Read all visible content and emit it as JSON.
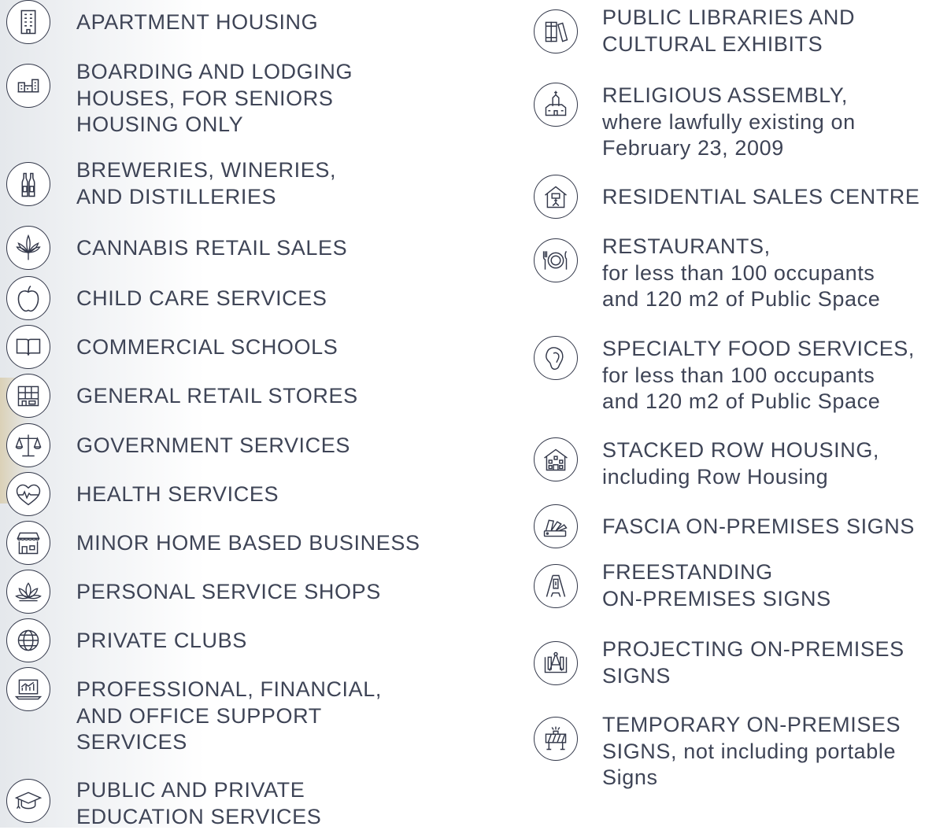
{
  "left_column": [
    {
      "icon": "apartment-building-icon",
      "lines": [
        "APARTMENT HOUSING"
      ]
    },
    {
      "icon": "boarding-houses-icon",
      "lines": [
        "BOARDING AND LODGING",
        "HOUSES, FOR SENIORS",
        "HOUSING ONLY"
      ]
    },
    {
      "icon": "bottles-icon",
      "lines": [
        "BREWERIES, WINERIES,",
        "AND DISTILLERIES"
      ]
    },
    {
      "icon": "cannabis-leaf-icon",
      "lines": [
        "CANNABIS RETAIL SALES"
      ]
    },
    {
      "icon": "apple-icon",
      "lines": [
        "CHILD CARE SERVICES"
      ]
    },
    {
      "icon": "open-book-icon",
      "lines": [
        "COMMERCIAL SCHOOLS"
      ]
    },
    {
      "icon": "storefront-icon",
      "lines": [
        "GENERAL RETAIL STORES"
      ]
    },
    {
      "icon": "scales-icon",
      "lines": [
        "GOVERNMENT SERVICES"
      ]
    },
    {
      "icon": "heart-pulse-icon",
      "lines": [
        "HEALTH SERVICES"
      ]
    },
    {
      "icon": "shop-awning-icon",
      "lines": [
        "MINOR HOME BASED BUSINESS"
      ]
    },
    {
      "icon": "lotus-icon",
      "lines": [
        "PERSONAL SERVICE SHOPS"
      ]
    },
    {
      "icon": "globe-icon",
      "lines": [
        "PRIVATE CLUBS"
      ]
    },
    {
      "icon": "laptop-chart-icon",
      "lines": [
        "PROFESSIONAL, FINANCIAL,",
        "AND OFFICE SUPPORT",
        "SERVICES"
      ]
    },
    {
      "icon": "graduation-cap-icon",
      "lines": [
        "PUBLIC AND PRIVATE",
        "EDUCATION SERVICES"
      ]
    }
  ],
  "right_column": [
    {
      "icon": "books-icon",
      "lines": [
        "PUBLIC LIBRARIES AND",
        "CULTURAL EXHIBITS"
      ],
      "sub": []
    },
    {
      "icon": "church-icon",
      "lines": [
        "RELIGIOUS ASSEMBLY,"
      ],
      "sub": [
        "where lawfully existing on",
        "February 23, 2009"
      ]
    },
    {
      "icon": "sales-house-icon",
      "lines": [
        "RESIDENTIAL SALES CENTRE"
      ],
      "sub": []
    },
    {
      "icon": "plate-cutlery-icon",
      "lines": [
        "RESTAURANTS,"
      ],
      "sub": [
        "for less than 100 occupants",
        "and 120 m2 of Public Space"
      ]
    },
    {
      "icon": "steak-icon",
      "lines": [
        "SPECIALTY FOOD SERVICES,"
      ],
      "sub": [
        "for less than 100 occupants",
        "and 120 m2 of Public Space"
      ]
    },
    {
      "icon": "row-house-icon",
      "lines": [
        "STACKED ROW HOUSING,"
      ],
      "sub": [
        "including Row Housing"
      ]
    },
    {
      "icon": "swatch-fan-icon",
      "lines": [
        "FASCIA ON-PREMISES SIGNS"
      ],
      "sub": []
    },
    {
      "icon": "sandwich-board-icon",
      "lines": [
        "FREESTANDING",
        "ON-PREMISES SIGNS"
      ],
      "sub": []
    },
    {
      "icon": "drafting-compass-icon",
      "lines": [
        "PROJECTING ON-PREMISES",
        "SIGNS"
      ],
      "sub": []
    },
    {
      "icon": "barricade-icon",
      "lines": [
        "TEMPORARY ON-PREMISES",
        "SIGNS,"
      ],
      "sub_inline": " not including portable",
      "sub": [
        "Signs"
      ]
    }
  ]
}
